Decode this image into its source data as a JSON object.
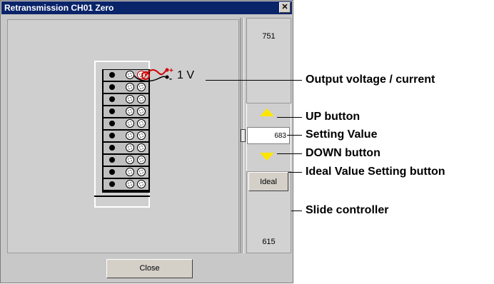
{
  "dialog": {
    "title": "Retransmission CH01 Zero",
    "close_glyph": "✕",
    "output_label": "1 V",
    "slider": {
      "max_value": "751",
      "min_value": "615",
      "setting_value": "683",
      "ideal_label": "Ideal"
    },
    "close_label": "Close"
  },
  "callouts": {
    "output": "Output voltage / current",
    "up": "UP button",
    "setting": "Setting Value",
    "down": "DOWN button",
    "ideal": "Ideal Value Setting button",
    "slide": "Slide controller"
  },
  "colors": {
    "title_bar": "#0a246a",
    "arrow": "#ffe600",
    "wire_red": "#d40000"
  }
}
